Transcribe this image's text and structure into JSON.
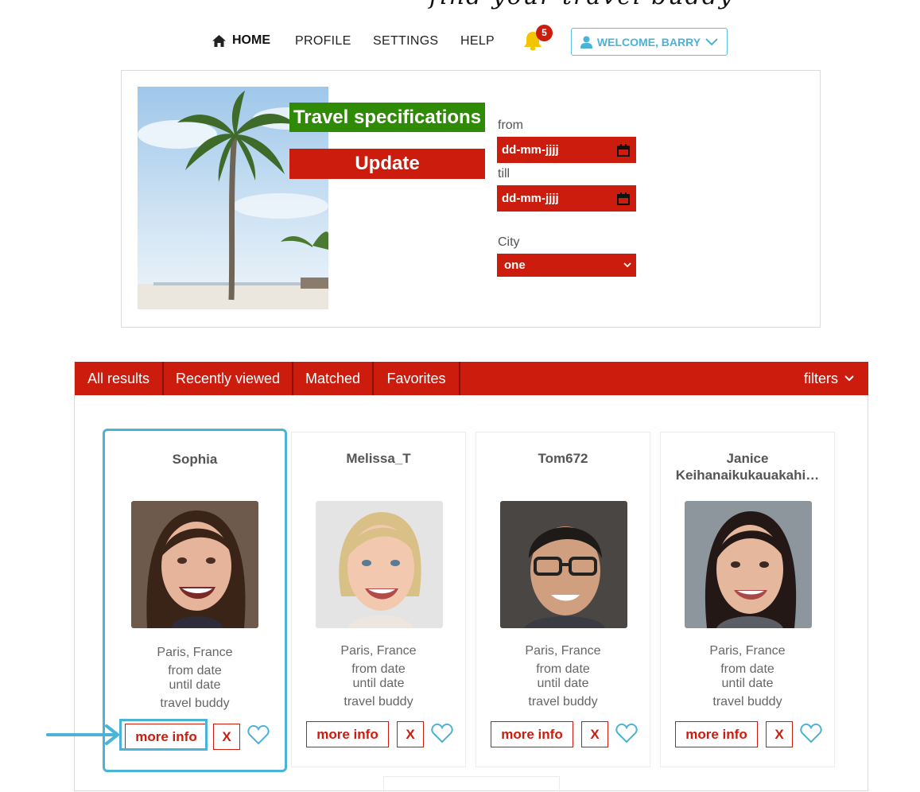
{
  "header": {
    "tagline": "find your travel buddy"
  },
  "nav": {
    "home": "HOME",
    "profile": "PROFILE",
    "settings": "SETTINGS",
    "help": "HELP",
    "notification_count": "5",
    "welcome": "WELCOME, BARRY"
  },
  "spec": {
    "title": "Travel specifications",
    "update": "Update",
    "from_label": "from",
    "from_value": "dd-mm-jjjj",
    "till_label": "till",
    "till_value": "dd-mm-jjjj",
    "city_label": "City",
    "city_value": "one"
  },
  "tabs": [
    "All results",
    "Recently viewed",
    "Matched",
    "Favorites"
  ],
  "filters_label": "filters",
  "cards": [
    {
      "name": "Sophia",
      "location": "Paris, France",
      "from": "from date",
      "until": "until date",
      "type": "travel buddy",
      "more": "more info",
      "dismiss": "X"
    },
    {
      "name": "Melissa_T",
      "location": "Paris, France",
      "from": "from date",
      "until": "until date",
      "type": "travel buddy",
      "more": "more info",
      "dismiss": "X"
    },
    {
      "name": "Tom672",
      "location": "Paris, France",
      "from": "from date",
      "until": "until date",
      "type": "travel buddy",
      "more": "more info",
      "dismiss": "X"
    },
    {
      "name": "Janice Keihanaikukauakahi…",
      "location": "Paris, France",
      "from": "from date",
      "until": "until date",
      "type": "travel buddy",
      "more": "more info",
      "dismiss": "X"
    }
  ],
  "colors": {
    "brand_red": "#cc1c0e",
    "accent_green": "#2f8a06",
    "accent_blue": "#4ab3d6"
  },
  "icons": [
    "home-icon",
    "bell-icon",
    "user-icon",
    "chevron-down-icon",
    "calendar-icon",
    "heart-icon"
  ]
}
